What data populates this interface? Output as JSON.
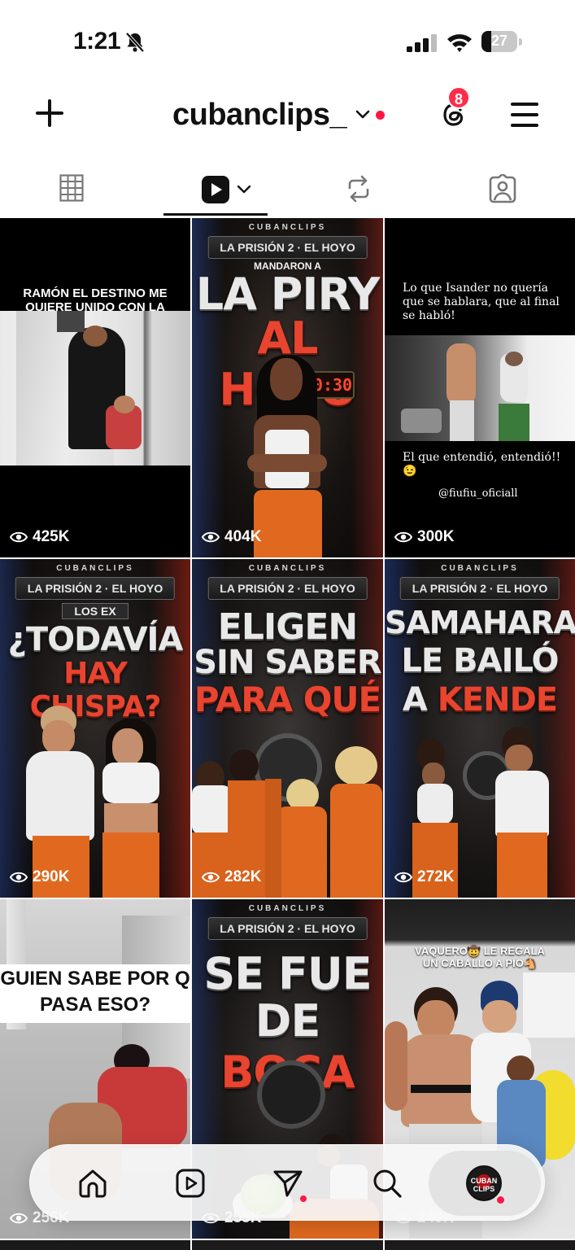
{
  "status_bar": {
    "time": "1:21",
    "battery": "27",
    "battery_level_percent": 27
  },
  "header": {
    "username": "cubanclips_",
    "threads_badge": "8"
  },
  "tabs": [
    {
      "icon": "grid-icon"
    },
    {
      "icon": "reels-icon",
      "active": true
    },
    {
      "icon": "reposts-icon"
    },
    {
      "icon": "tagged-icon"
    }
  ],
  "posts": [
    {
      "views": "425K",
      "caption": "RAMÓN EL DESTINO ME QUIERE UNIDO CON LA HONY"
    },
    {
      "views": "404K",
      "brand": "CUBANCLIPS",
      "banner": "LA PRISIÓN 2 · EL HOYO",
      "tag": "MANDARON A",
      "line1": "LA PIRY",
      "line2": "AL HOYO",
      "timer": "00:30"
    },
    {
      "views": "300K",
      "caption_top": "Lo que Isander no quería que se hablara, que al final se habló!",
      "caption_mid": "El que entendió, entendió!!😉",
      "handle": "@fiufiu_oficiall"
    },
    {
      "views": "290K",
      "brand": "CUBANCLIPS",
      "banner": "LA PRISIÓN 2 · EL HOYO",
      "tag": "LOS EX",
      "line1": "¿TODAVÍA",
      "line2": "HAY CHISPA?"
    },
    {
      "views": "282K",
      "brand": "CUBANCLIPS",
      "banner": "LA PRISIÓN 2 · EL HOYO",
      "line1": "ELIGEN",
      "line2": "SIN SABER",
      "line3": "PARA QUÉ"
    },
    {
      "views": "272K",
      "brand": "CUBANCLIPS",
      "banner": "LA PRISIÓN 2 · EL HOYO",
      "line1": "SAMAHARA",
      "line2": "LE BAILÓ",
      "line3a": "A ",
      "line3b": "KENDE"
    },
    {
      "views": "256K",
      "caption": "GUIEN SABE POR Q PASA ESO?"
    },
    {
      "views": "255K",
      "brand": "CUBANCLIPS",
      "banner": "LA PRISIÓN 2 · EL HOYO",
      "line1": "SE FUE",
      "line2a": "DE ",
      "line2b": "BOCA"
    },
    {
      "views": "240K",
      "caption": "VAQUERO🤠 LE REGALA UN CABALLO A PIO🐴"
    }
  ],
  "bottom_nav": [
    {
      "icon": "home-icon"
    },
    {
      "icon": "reels-icon"
    },
    {
      "icon": "send-icon",
      "has_dot": true
    },
    {
      "icon": "search-icon"
    },
    {
      "icon": "profile-avatar",
      "avatar_text": "CUBAN CLIPS",
      "has_dot": true
    }
  ]
}
